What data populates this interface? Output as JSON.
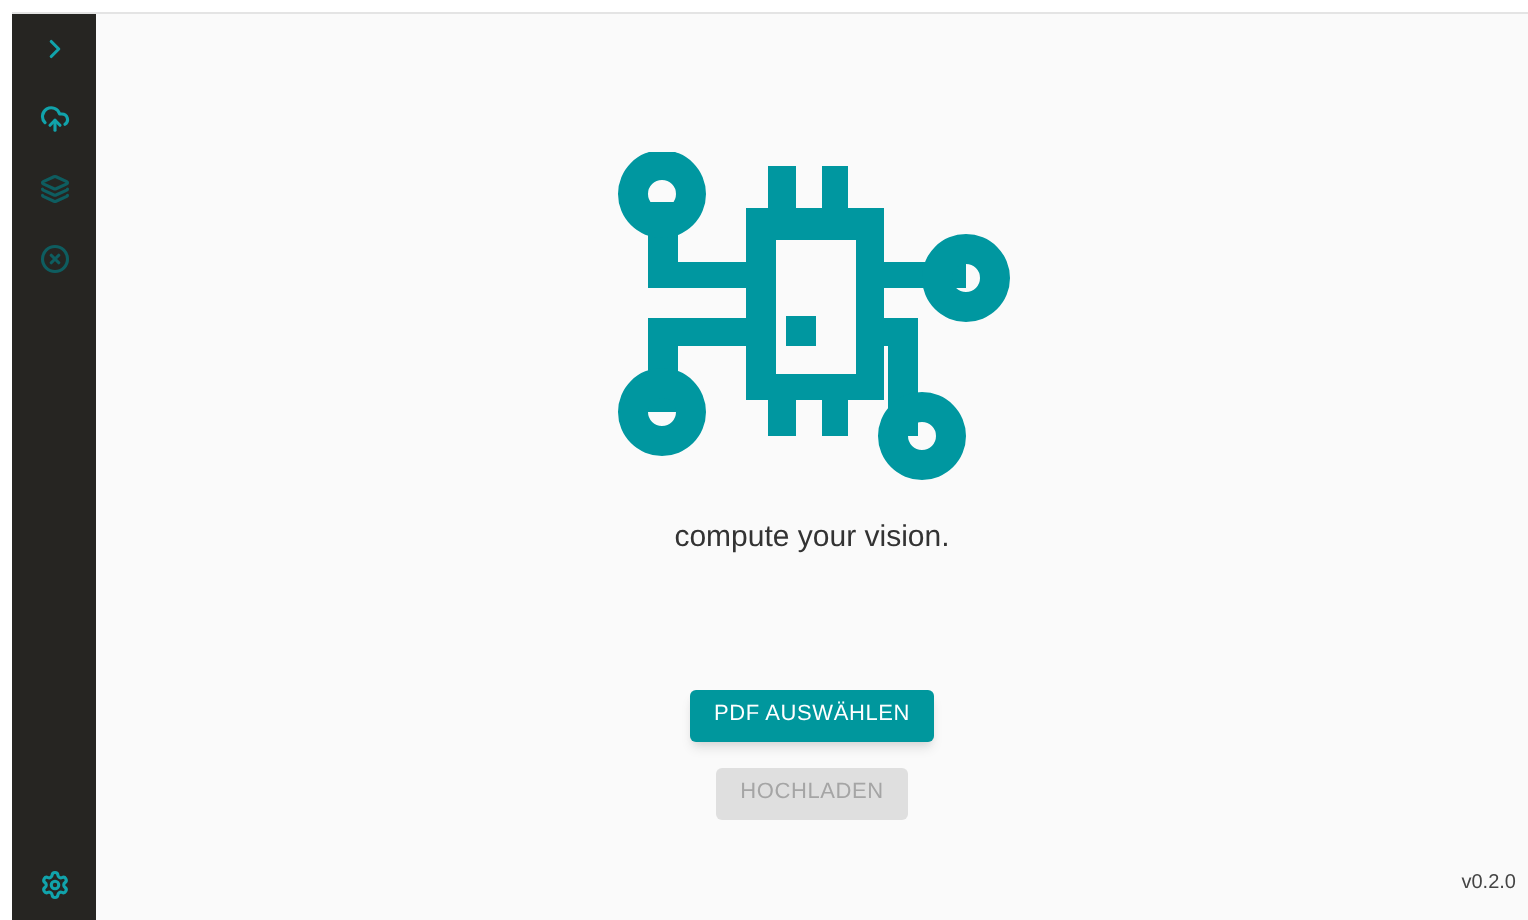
{
  "sidebar": {
    "items": [
      {
        "kind": "expand",
        "disabled": false
      },
      {
        "kind": "upload",
        "disabled": false
      },
      {
        "kind": "layers",
        "disabled": true
      },
      {
        "kind": "cancel",
        "disabled": true
      }
    ],
    "footer": {
      "kind": "settings"
    }
  },
  "tagline": "compute your vision.",
  "buttons": [
    {
      "label": "PDF AUSWÄHLEN",
      "disabled": false
    },
    {
      "label": "HOCHLADEN",
      "disabled": true
    }
  ],
  "version": "v0.2.0"
}
